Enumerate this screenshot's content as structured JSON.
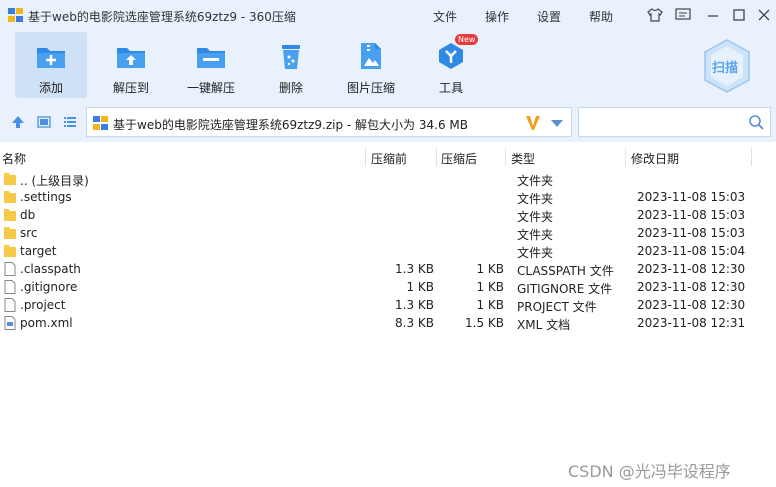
{
  "window": {
    "title": "基于web的电影院选座管理系统69ztz9 - 360压缩",
    "menu": [
      "文件",
      "操作",
      "设置",
      "帮助"
    ]
  },
  "toolbar": {
    "items": [
      {
        "label": "添加",
        "icon": "add-icon"
      },
      {
        "label": "解压到",
        "icon": "extract-to-icon"
      },
      {
        "label": "一键解压",
        "icon": "one-click-extract-icon"
      },
      {
        "label": "删除",
        "icon": "delete-icon"
      },
      {
        "label": "图片压缩",
        "icon": "image-compress-icon"
      },
      {
        "label": "工具",
        "icon": "tools-icon"
      }
    ],
    "new_badge": "New",
    "scan_label": "扫描"
  },
  "address": {
    "path": "基于web的电影院选座管理系统69ztz9.zip - 解包大小为 34.6 MB",
    "search_placeholder": ""
  },
  "table": {
    "columns": [
      "名称",
      "压缩前",
      "压缩后",
      "类型",
      "修改日期"
    ],
    "rows": [
      {
        "name": ".. (上级目录)",
        "before": "",
        "after": "",
        "type": "文件夹",
        "date": "",
        "kind": "folder"
      },
      {
        "name": ".settings",
        "before": "",
        "after": "",
        "type": "文件夹",
        "date": "2023-11-08 15:03",
        "kind": "folder"
      },
      {
        "name": "db",
        "before": "",
        "after": "",
        "type": "文件夹",
        "date": "2023-11-08 15:03",
        "kind": "folder"
      },
      {
        "name": "src",
        "before": "",
        "after": "",
        "type": "文件夹",
        "date": "2023-11-08 15:03",
        "kind": "folder"
      },
      {
        "name": "target",
        "before": "",
        "after": "",
        "type": "文件夹",
        "date": "2023-11-08 15:04",
        "kind": "folder"
      },
      {
        "name": ".classpath",
        "before": "1.3 KB",
        "after": "1 KB",
        "type": "CLASSPATH 文件",
        "date": "2023-11-08 12:30",
        "kind": "file"
      },
      {
        "name": ".gitignore",
        "before": "1 KB",
        "after": "1 KB",
        "type": "GITIGNORE 文件",
        "date": "2023-11-08 12:30",
        "kind": "file"
      },
      {
        "name": ".project",
        "before": "1.3 KB",
        "after": "1 KB",
        "type": "PROJECT 文件",
        "date": "2023-11-08 12:30",
        "kind": "file"
      },
      {
        "name": "pom.xml",
        "before": "8.3 KB",
        "after": "1.5 KB",
        "type": "XML 文档",
        "date": "2023-11-08 12:31",
        "kind": "xml"
      }
    ]
  },
  "watermark": "CSDN @光冯毕设程序",
  "colors": {
    "accent": "#2f8ae5",
    "folder": "#f7c948",
    "titlebar": "#e8f1fc"
  }
}
